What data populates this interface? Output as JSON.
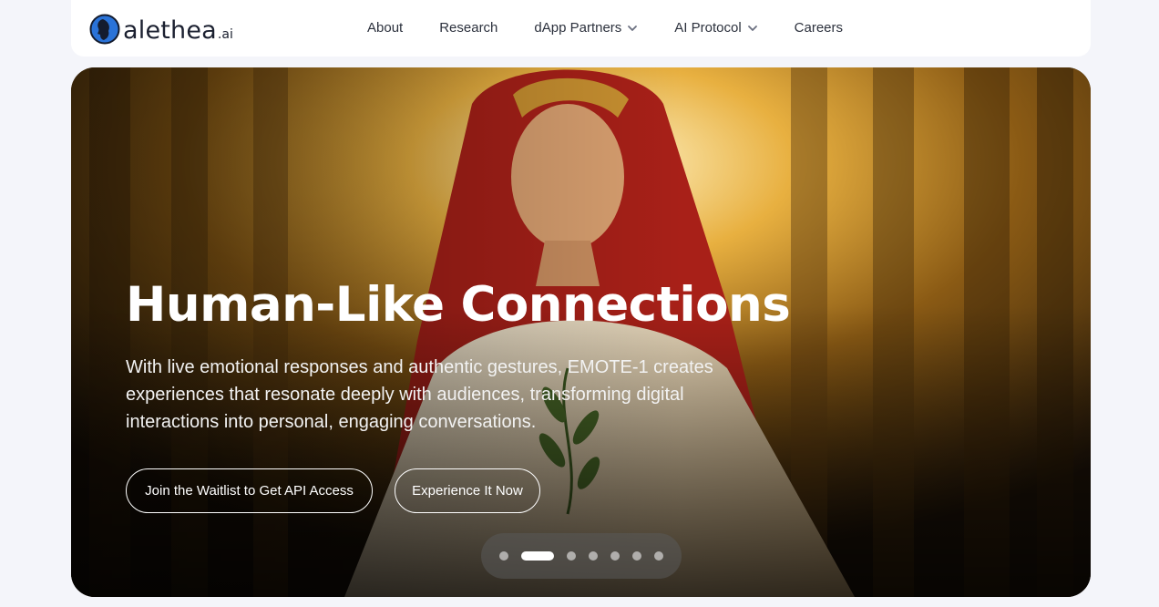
{
  "brand": {
    "name": "alethea",
    "suffix": ".ai",
    "logo_icon": "alethea-head-logo-icon",
    "logo_color": "#2a73d8"
  },
  "nav": {
    "items": [
      {
        "label": "About",
        "has_dropdown": false
      },
      {
        "label": "Research",
        "has_dropdown": false
      },
      {
        "label": "dApp Partners",
        "has_dropdown": true
      },
      {
        "label": "AI Protocol",
        "has_dropdown": true
      },
      {
        "label": "Careers",
        "has_dropdown": false
      }
    ]
  },
  "hero": {
    "title": "Human-Like Connections",
    "subtitle": "With live emotional responses and authentic gestures, EMOTE-1 creates experiences that resonate deeply with audiences, transforming digital interactions into personal, engaging conversations.",
    "primary_button": "Join the Waitlist to Get API Access",
    "secondary_button": "Experience It Now",
    "image_subject": "woman in red veil and white robe meditating among golden temple columns holding an olive branch"
  },
  "carousel": {
    "total_slides": 7,
    "active_slide": 2
  },
  "colors": {
    "page_bg": "#f4f5fa",
    "nav_bg": "#ffffff",
    "nav_text": "#2c313d",
    "hero_text": "#ffffff"
  }
}
